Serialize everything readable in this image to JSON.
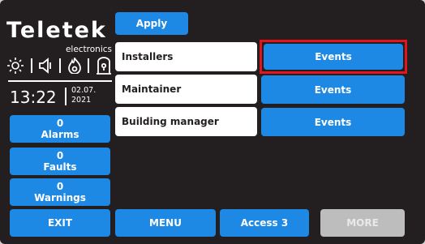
{
  "brand": {
    "name": "Teletek",
    "subtitle": "electronics"
  },
  "status_icons": [
    "sun-icon",
    "speaker-icon",
    "flame-icon",
    "door-icon"
  ],
  "clock": {
    "time": "13:22",
    "date_line1": "02.07.",
    "date_line2": "2021"
  },
  "counters": [
    {
      "count": "0",
      "label": "Alarms"
    },
    {
      "count": "0",
      "label": "Faults"
    },
    {
      "count": "0",
      "label": "Warnings"
    }
  ],
  "toolbar": {
    "apply_label": "Apply"
  },
  "users": [
    {
      "role": "Installers",
      "action": "Events",
      "selected": true
    },
    {
      "role": "Maintainer",
      "action": "Events",
      "selected": false
    },
    {
      "role": "Building manager",
      "action": "Events",
      "selected": false
    }
  ],
  "bottom_bar": {
    "exit_label": "EXIT",
    "menu_label": "MENU",
    "access_label": "Access 3",
    "more_label": "MORE"
  },
  "colors": {
    "background": "#231f20",
    "accent": "#1e88e5",
    "selection": "#e3141b",
    "disabled": "#bdbdbd"
  }
}
